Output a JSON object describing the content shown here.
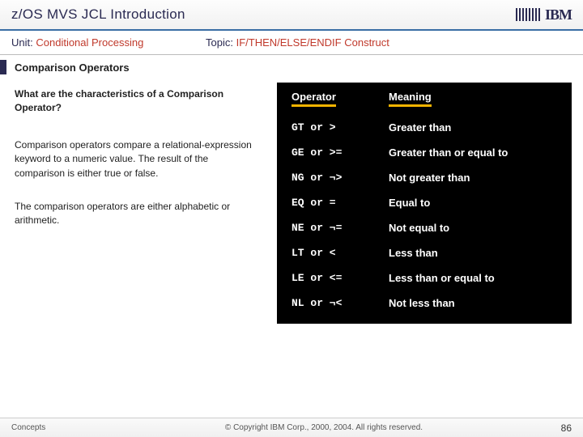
{
  "title": "z/OS MVS JCL Introduction",
  "unit_label": "Unit:",
  "unit_value": "Conditional Processing",
  "topic_label": "Topic:",
  "topic_value": "IF/THEN/ELSE/ENDIF Construct",
  "section_heading": "Comparison Operators",
  "question": "What are the characteristics of a Comparison Operator?",
  "para1": "Comparison operators compare a relational-expression keyword to a numeric value. The result of the comparison is either true or false.",
  "para2": "The comparison operators are either alphabetic or arithmetic.",
  "table": {
    "head_op": "Operator",
    "head_mn": "Meaning",
    "rows": [
      {
        "op": "GT or >",
        "mn": "Greater than"
      },
      {
        "op": "GE or >=",
        "mn": "Greater than or equal to"
      },
      {
        "op": "NG or ¬>",
        "mn": "Not greater than"
      },
      {
        "op": "EQ or =",
        "mn": "Equal to"
      },
      {
        "op": "NE or ¬=",
        "mn": "Not equal to"
      },
      {
        "op": "LT or <",
        "mn": "Less than"
      },
      {
        "op": "LE or <=",
        "mn": "Less than or equal to"
      },
      {
        "op": "NL or ¬<",
        "mn": "Not less than"
      }
    ]
  },
  "footer_left": "Concepts",
  "footer_center": "© Copyright IBM Corp., 2000, 2004. All rights reserved.",
  "footer_page": "86",
  "logo_text": "IBM"
}
